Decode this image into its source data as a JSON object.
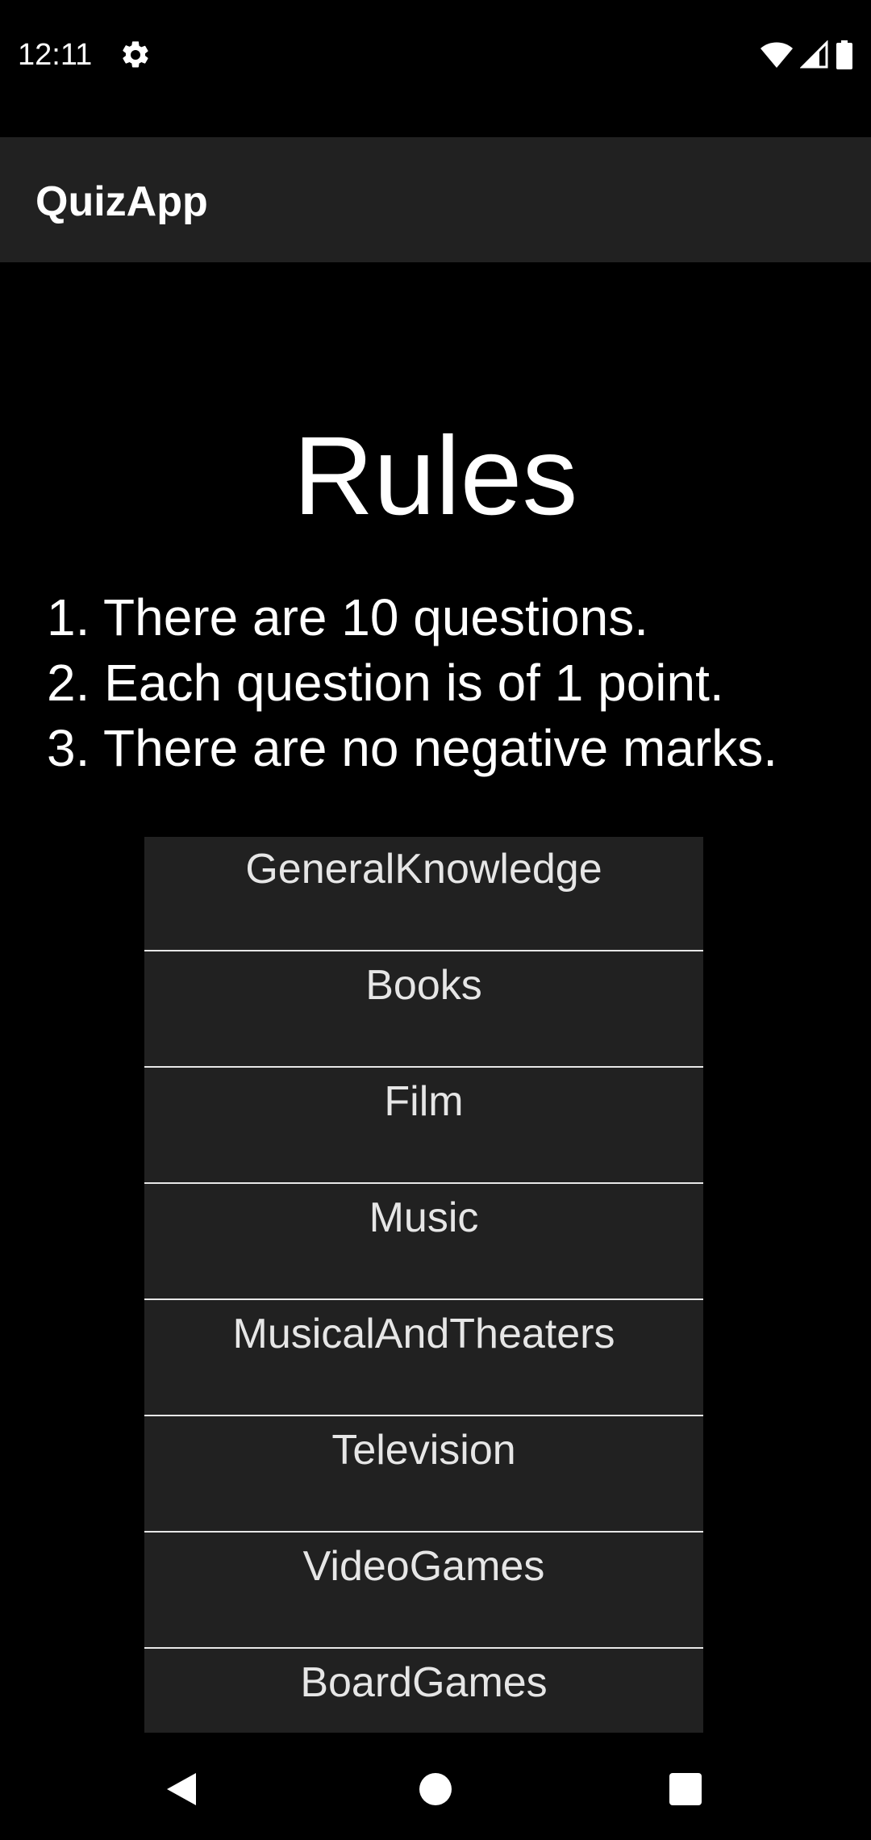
{
  "status_bar": {
    "time": "12:11",
    "icons": [
      "settings-icon",
      "wifi-icon",
      "signal-icon",
      "battery-icon"
    ]
  },
  "app_bar": {
    "title": "QuizApp"
  },
  "rules": {
    "title": "Rules",
    "items": [
      "1. There are 10 questions.",
      "2. Each question is of 1 point.",
      "3. There are no negative marks."
    ]
  },
  "categories": [
    "GeneralKnowledge",
    "Books",
    "Film",
    "Music",
    "MusicalAndTheaters",
    "Television",
    "VideoGames",
    "BoardGames"
  ],
  "nav_bar": {
    "icons": [
      "back-icon",
      "home-icon",
      "recents-icon"
    ]
  },
  "colors": {
    "background": "#000000",
    "app_bar": "#212121",
    "list_item": "#212121",
    "divider": "#e8e8e8",
    "text": "#ffffff"
  }
}
